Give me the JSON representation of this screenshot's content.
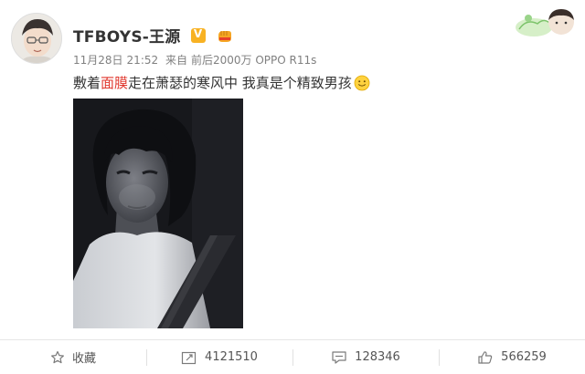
{
  "post": {
    "username": "TFBOYS-王源",
    "verified_badge": "V",
    "meta": {
      "date": "11月28日",
      "time": "21:52",
      "source_prefix": "来自",
      "source": "前后2000万 OPPO R11s"
    },
    "text": {
      "part1": "敷着",
      "highlight": "面膜",
      "part2": "走在萧瑟的寒风中 我真是个精致男孩"
    },
    "icons": {
      "verified": "verified-v-icon",
      "badge": "fist-badge-icon",
      "emoji": "smile-emoji-icon"
    }
  },
  "actions": [
    {
      "icon": "star-icon",
      "label": "收藏"
    },
    {
      "icon": "repost-icon",
      "label": "4121510"
    },
    {
      "icon": "comment-icon",
      "label": "128346"
    },
    {
      "icon": "like-icon",
      "label": "566259"
    }
  ],
  "colors": {
    "highlight": "#e0362c",
    "meta_text": "#808080",
    "badge_v": "#f8b223"
  }
}
